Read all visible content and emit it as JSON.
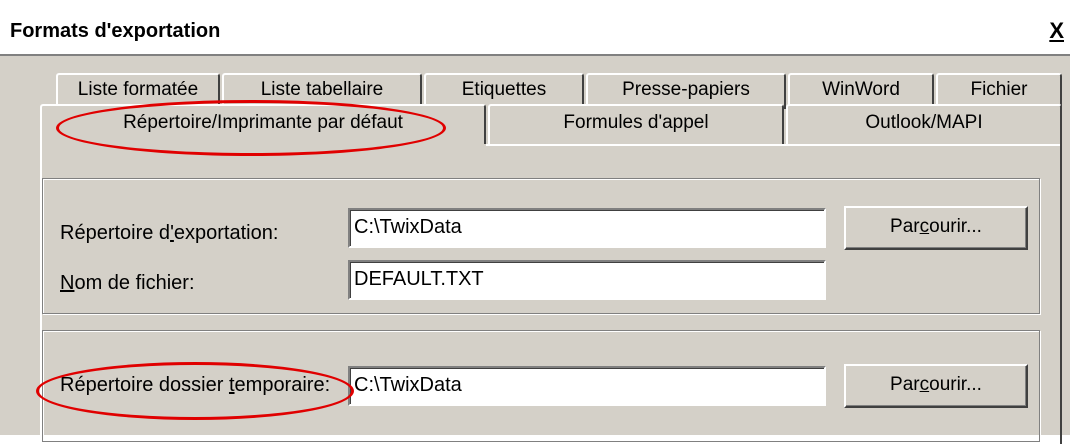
{
  "window": {
    "title": "Formats d'exportation",
    "close_glyph": "X"
  },
  "tabs_row1": [
    {
      "label": "Liste formatée"
    },
    {
      "label": "Liste tabellaire"
    },
    {
      "label": "Etiquettes"
    },
    {
      "label": "Presse-papiers"
    },
    {
      "label": "WinWord"
    },
    {
      "label": "Fichier"
    }
  ],
  "tabs_row2": [
    {
      "label": "Répertoire/Imprimante par défaut",
      "active": true
    },
    {
      "label": "Formules d'appel"
    },
    {
      "label": "Outlook/MAPI"
    }
  ],
  "export_group": {
    "dir_label_pre": "Répertoire d",
    "dir_label_u": "'",
    "dir_label_post": "exportation:",
    "dir_value": "C:\\TwixData",
    "browse_pre": "Par",
    "browse_u": "c",
    "browse_post": "ourir...",
    "file_label_u": "N",
    "file_label_post": "om de fichier:",
    "file_value": "DEFAULT.TXT"
  },
  "temp_group": {
    "dir_label_pre": "Répertoire dossier ",
    "dir_label_u": "t",
    "dir_label_post": "emporaire:",
    "dir_value": "C:\\TwixData",
    "browse_pre": "Par",
    "browse_u": "c",
    "browse_post": "ourir..."
  },
  "colors": {
    "dialog_bg": "#d4d0c8",
    "highlight_ellipse": "#e00000"
  }
}
